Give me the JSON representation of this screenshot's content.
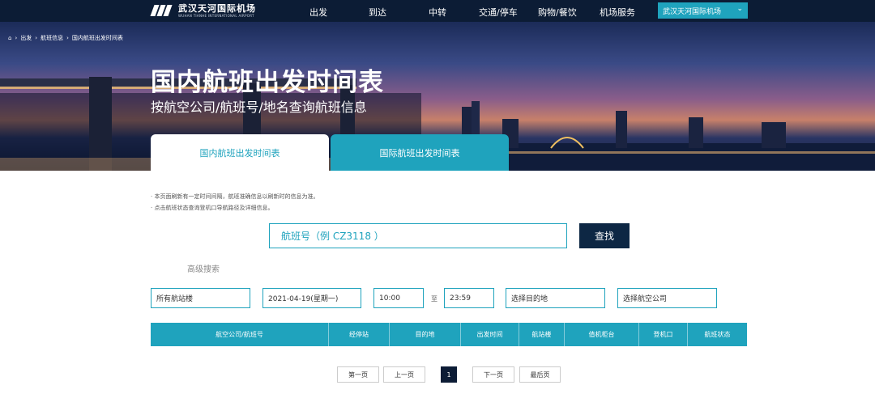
{
  "brand": {
    "name_cn": "武汉天河国际机场",
    "name_en": "WUHAN TIANHE INTERNATIONAL AIRPORT"
  },
  "nav": {
    "items": [
      "出发",
      "到达",
      "中转",
      "交通/停车",
      "购物/餐饮",
      "机场服务"
    ],
    "airport_select": "武汉天河国际机场"
  },
  "breadcrumb": [
    "出发",
    "航班信息",
    "国内航班出发时间表"
  ],
  "hero": {
    "title": "国内航班出发时间表",
    "subtitle": "按航空公司/航班号/地名查询航班信息"
  },
  "tabs": {
    "domestic": "国内航班出发时间表",
    "international": "国际航班出发时间表"
  },
  "notes": [
    "· 本页面刷新有一定时间间隔，航班准确信息以刷新时的信息为准。",
    "· 点击航班状态查询登机口导航路径及详细信息。"
  ],
  "search": {
    "placeholder": "航班号（例 CZ3118 ）",
    "button": "查找",
    "advanced": "高级搜索"
  },
  "filters": {
    "terminal": "所有航站楼",
    "date": "2021-04-19(星期一)",
    "time_from": "10:00",
    "to_label": "至",
    "time_to": "23:59",
    "destination": "选择目的地",
    "airline": "选择航空公司"
  },
  "table": {
    "columns": [
      "航空公司/航班号",
      "经停站",
      "目的地",
      "出发时间",
      "航站楼",
      "值机柜台",
      "登机口",
      "航班状态"
    ]
  },
  "pagination": {
    "first": "第一页",
    "prev": "上一页",
    "current": "1",
    "next": "下一页",
    "last": "最后页"
  },
  "colors": {
    "nav_bg": "#0c1c35",
    "accent": "#1fa3bd",
    "button_dark": "#0d2744"
  }
}
